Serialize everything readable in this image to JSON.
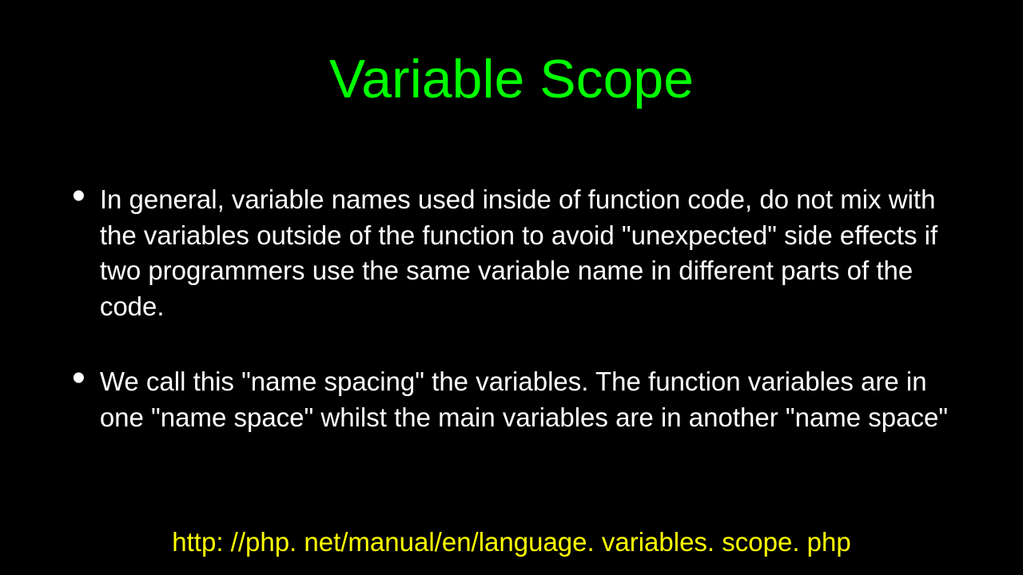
{
  "title": "Variable Scope",
  "bullets": [
    "In general, variable names used inside of function code, do not mix with the variables outside of the function to avoid \"unexpected\" side effects if two programmers use the same variable name in different parts of the code.",
    "We call this \"name spacing\" the variables.   The function variables are in one \"name space\" whilst the main variables are in another \"name space\""
  ],
  "link": "http: //php. net/manual/en/language. variables. scope. php"
}
